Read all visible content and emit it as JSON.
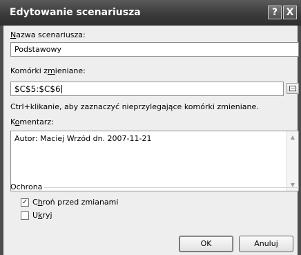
{
  "dialog": {
    "title": "Edytowanie scenariusza",
    "help_button": "?",
    "close_button": "X"
  },
  "scenario_name": {
    "label_pre": "",
    "label_u": "N",
    "label_post": "azwa scenariusza:",
    "value": "Podstawowy"
  },
  "changing_cells": {
    "label_pre": "Komórki z",
    "label_u": "m",
    "label_post": "ieniane:",
    "value": "$C$5:$C$6",
    "hint": "Ctrl+klikanie, aby zaznaczyć nieprzylegające komórki zmieniane."
  },
  "comment": {
    "label_pre": "K",
    "label_u": "o",
    "label_post": "mentarz:",
    "value": "Autor: Maciej Wrzód dn. 2007-11-21"
  },
  "protection": {
    "group_label": "Ochrona",
    "prevent_changes": {
      "label_pre": "C",
      "label_u": "h",
      "label_post": "roń przed zmianami",
      "checked": true,
      "mark": "✓"
    },
    "hide": {
      "label_pre": "U",
      "label_u": "k",
      "label_post": "ryj",
      "checked": false,
      "mark": ""
    }
  },
  "buttons": {
    "ok": "OK",
    "cancel": "Anuluj"
  },
  "colors": {
    "titlebar": "#3b3b3b",
    "dialog_bg": "#eeeeee",
    "frame": "#4d4d4d"
  }
}
